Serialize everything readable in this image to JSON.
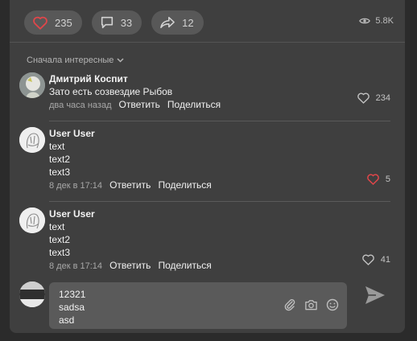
{
  "post_actions": {
    "likes": "235",
    "comments": "33",
    "shares": "12",
    "views": "5.8K",
    "like_color": "#e0464a"
  },
  "sort": {
    "label": "Сначала интересные"
  },
  "comments": [
    {
      "author": "Дмитрий Коспит",
      "lines": [
        "Зато есть созвездие Рыбов"
      ],
      "time": "два часа назад",
      "reply_label": "Ответить",
      "share_label": "Поделиться",
      "likes": "234",
      "liked": false
    },
    {
      "author": "User User",
      "lines": [
        "text",
        "text2",
        "text3"
      ],
      "time": "8 дек в 17:14",
      "reply_label": "Ответить",
      "share_label": "Поделиться",
      "likes": "5",
      "liked": true
    },
    {
      "author": "User User",
      "lines": [
        "text",
        "text2",
        "text3"
      ],
      "time": "8 дек в 17:14",
      "reply_label": "Ответить",
      "share_label": "Поделиться",
      "likes": "41",
      "liked": false
    }
  ],
  "composer": {
    "lines": [
      "12321",
      "sadsa",
      "asd"
    ],
    "icons": [
      "paperclip-icon",
      "camera-icon",
      "smile-icon"
    ]
  },
  "send_icon": "send-icon"
}
